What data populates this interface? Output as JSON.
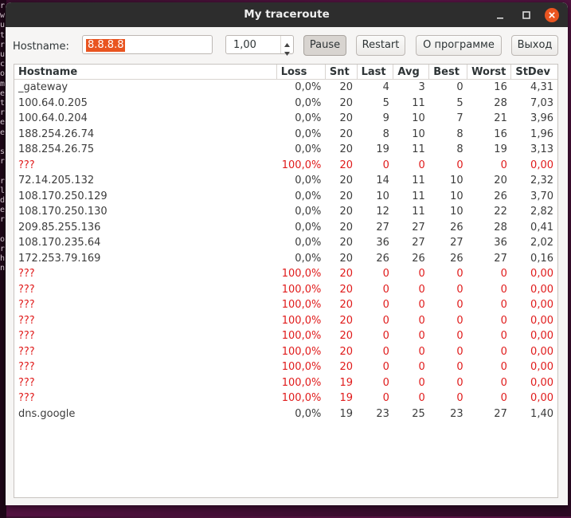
{
  "background_terminal_chars": [
    "r",
    "w",
    "u",
    "t",
    "r",
    "u",
    "c",
    "o",
    "m",
    "e",
    "t",
    "r",
    "e",
    "e",
    "",
    "s",
    "r",
    "",
    "r",
    "l",
    "d",
    "e",
    "r",
    "",
    "o",
    "r",
    "h",
    "n"
  ],
  "window": {
    "title": "My traceroute",
    "controls": [
      "minimize-icon",
      "maximize-icon",
      "close-icon"
    ],
    "close_color": "#e95420"
  },
  "toolbar": {
    "hostname_label": "Hostname:",
    "hostname_value": "8.8.8.8",
    "interval_value": "1,00",
    "pause_label": "Pause",
    "restart_label": "Restart",
    "about_label": "О программе",
    "exit_label": "Выход"
  },
  "table": {
    "columns": [
      "Hostname",
      "Loss",
      "Snt",
      "Last",
      "Avg",
      "Best",
      "Worst",
      "StDev"
    ],
    "rows": [
      [
        "_gateway",
        "0,0%",
        "20",
        "4",
        "3",
        "0",
        "16",
        "4,31"
      ],
      [
        "100.64.0.205",
        "0,0%",
        "20",
        "5",
        "11",
        "5",
        "28",
        "7,03"
      ],
      [
        "100.64.0.204",
        "0,0%",
        "20",
        "9",
        "10",
        "7",
        "21",
        "3,96"
      ],
      [
        "188.254.26.74",
        "0,0%",
        "20",
        "8",
        "10",
        "8",
        "16",
        "1,96"
      ],
      [
        "188.254.26.75",
        "0,0%",
        "20",
        "19",
        "11",
        "8",
        "19",
        "3,13"
      ],
      [
        "???",
        "100,0%",
        "20",
        "0",
        "0",
        "0",
        "0",
        "0,00"
      ],
      [
        "72.14.205.132",
        "0,0%",
        "20",
        "14",
        "11",
        "10",
        "20",
        "2,32"
      ],
      [
        "108.170.250.129",
        "0,0%",
        "20",
        "10",
        "11",
        "10",
        "26",
        "3,70"
      ],
      [
        "108.170.250.130",
        "0,0%",
        "20",
        "12",
        "11",
        "10",
        "22",
        "2,82"
      ],
      [
        "209.85.255.136",
        "0,0%",
        "20",
        "27",
        "27",
        "26",
        "28",
        "0,41"
      ],
      [
        "108.170.235.64",
        "0,0%",
        "20",
        "36",
        "27",
        "27",
        "36",
        "2,02"
      ],
      [
        "172.253.79.169",
        "0,0%",
        "20",
        "26",
        "26",
        "26",
        "27",
        "0,16"
      ],
      [
        "???",
        "100,0%",
        "20",
        "0",
        "0",
        "0",
        "0",
        "0,00"
      ],
      [
        "???",
        "100,0%",
        "20",
        "0",
        "0",
        "0",
        "0",
        "0,00"
      ],
      [
        "???",
        "100,0%",
        "20",
        "0",
        "0",
        "0",
        "0",
        "0,00"
      ],
      [
        "???",
        "100,0%",
        "20",
        "0",
        "0",
        "0",
        "0",
        "0,00"
      ],
      [
        "???",
        "100,0%",
        "20",
        "0",
        "0",
        "0",
        "0",
        "0,00"
      ],
      [
        "???",
        "100,0%",
        "20",
        "0",
        "0",
        "0",
        "0",
        "0,00"
      ],
      [
        "???",
        "100,0%",
        "20",
        "0",
        "0",
        "0",
        "0",
        "0,00"
      ],
      [
        "???",
        "100,0%",
        "19",
        "0",
        "0",
        "0",
        "0",
        "0,00"
      ],
      [
        "???",
        "100,0%",
        "19",
        "0",
        "0",
        "0",
        "0",
        "0,00"
      ],
      [
        "dns.google",
        "0,0%",
        "19",
        "23",
        "25",
        "23",
        "27",
        "1,40"
      ]
    ],
    "lost_color": "#e01b1b"
  }
}
